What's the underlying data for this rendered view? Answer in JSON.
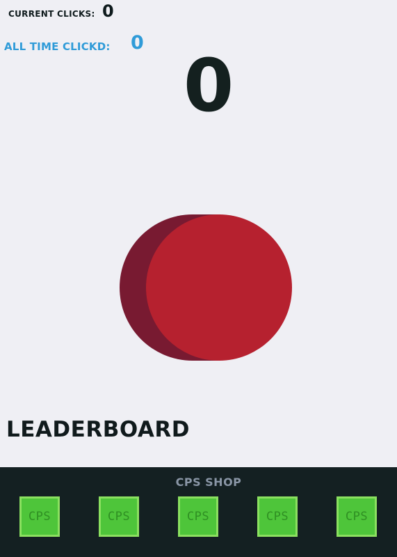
{
  "stats": {
    "current_label": "CURRENT CLICKS:",
    "current_value": "0",
    "alltime_label": "ALL TIME CLICKD:",
    "alltime_value": "0"
  },
  "counter": {
    "value": "0"
  },
  "leaderboard": {
    "title": "LEADERBOARD"
  },
  "shop": {
    "title": "CPS SHOP",
    "items": [
      {
        "label": "CPS"
      },
      {
        "label": "CPS"
      },
      {
        "label": "CPS"
      },
      {
        "label": "CPS"
      },
      {
        "label": "CPS"
      }
    ]
  },
  "colors": {
    "background": "#efeff4",
    "accent_blue": "#2f9bd8",
    "button_red": "#b6212f",
    "button_shadow": "#781a31",
    "shop_bg": "#142022",
    "shop_item_green": "#4ec53a"
  }
}
